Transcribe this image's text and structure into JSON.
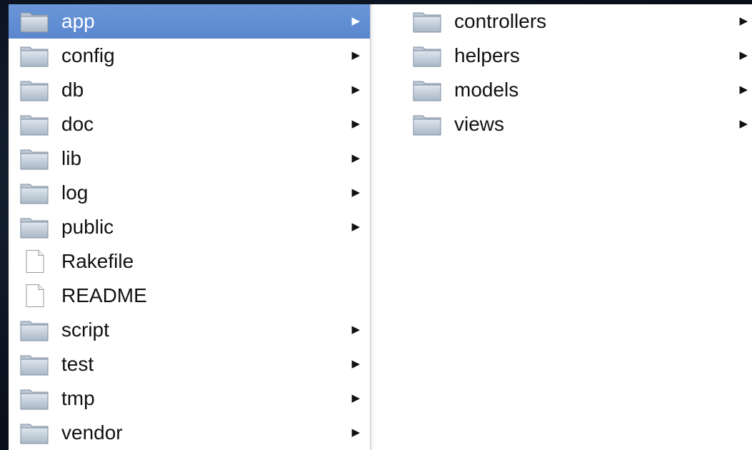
{
  "column_1": {
    "items": [
      {
        "label": "app",
        "type": "folder",
        "has_children": true,
        "selected": true
      },
      {
        "label": "config",
        "type": "folder",
        "has_children": true
      },
      {
        "label": "db",
        "type": "folder",
        "has_children": true
      },
      {
        "label": "doc",
        "type": "folder",
        "has_children": true
      },
      {
        "label": "lib",
        "type": "folder",
        "has_children": true
      },
      {
        "label": "log",
        "type": "folder",
        "has_children": true
      },
      {
        "label": "public",
        "type": "folder",
        "has_children": true
      },
      {
        "label": "Rakefile",
        "type": "file",
        "has_children": false
      },
      {
        "label": "README",
        "type": "file",
        "has_children": false
      },
      {
        "label": "script",
        "type": "folder",
        "has_children": true
      },
      {
        "label": "test",
        "type": "folder",
        "has_children": true
      },
      {
        "label": "tmp",
        "type": "folder",
        "has_children": true
      },
      {
        "label": "vendor",
        "type": "folder",
        "has_children": true
      }
    ]
  },
  "column_2": {
    "items": [
      {
        "label": "controllers",
        "type": "folder",
        "has_children": true
      },
      {
        "label": "helpers",
        "type": "folder",
        "has_children": true
      },
      {
        "label": "models",
        "type": "folder",
        "has_children": true
      },
      {
        "label": "views",
        "type": "folder",
        "has_children": true
      }
    ]
  },
  "glyphs": {
    "disclosure_arrow": "▶"
  },
  "icons": {
    "folder": "folder-icon",
    "file": "document-icon"
  },
  "colors": {
    "selection": "#5f8dd3",
    "text": "#111111",
    "selected_text": "#ffffff",
    "background": "#0b1320"
  }
}
